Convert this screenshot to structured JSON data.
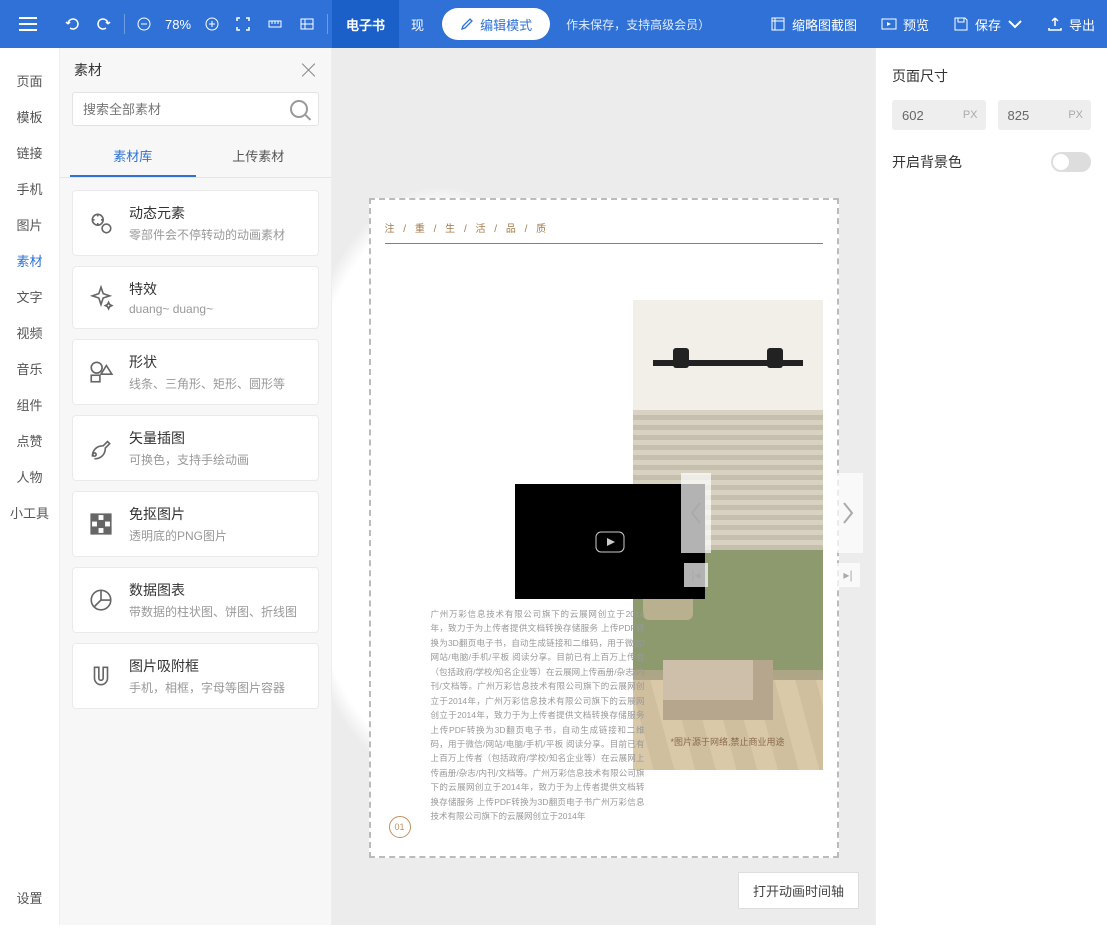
{
  "topbar": {
    "zoom": "78%",
    "mode_tabs": {
      "active": "电子书",
      "other": "现"
    },
    "edit_pill": "编辑模式",
    "status": "作未保存，支持高级会员）",
    "thumbnail": "缩略图截图",
    "preview": "预览",
    "save": "保存",
    "export": "导出"
  },
  "rail": {
    "items": [
      "页面",
      "模板",
      "链接",
      "手机",
      "图片",
      "素材",
      "文字",
      "视频",
      "音乐",
      "组件",
      "点赞",
      "人物",
      "小工具"
    ],
    "active_index": 5,
    "bottom": "设置"
  },
  "panel": {
    "title": "素材",
    "search_placeholder": "搜索全部素材",
    "tabs": {
      "library": "素材库",
      "upload": "上传素材"
    },
    "cards": [
      {
        "title": "动态元素",
        "desc": "零部件会不停转动的动画素材"
      },
      {
        "title": "特效",
        "desc": "duang~ duang~"
      },
      {
        "title": "形状",
        "desc": "线条、三角形、矩形、圆形等"
      },
      {
        "title": "矢量插图",
        "desc": "可换色，支持手绘动画"
      },
      {
        "title": "免抠图片",
        "desc": "透明底的PNG图片"
      },
      {
        "title": "数据图表",
        "desc": "带数据的柱状图、饼图、折线图"
      },
      {
        "title": "图片吸附框",
        "desc": "手机，相框，字母等图片容器"
      }
    ]
  },
  "canvas": {
    "header_text": "注 / 重 / 生 / 活 / 品 / 质",
    "photo_caption": "*图片源于网络,禁止商业用途",
    "body_text": "广州万彩信息技术有限公司旗下的云展网创立于2014年，致力于为上传者提供文档转换存储服务 上传PDF转换为3D翻页电子书，自动生成链接和二维码，用于微信/网站/电脑/手机/平板 阅读分享。目前已有上百万上传者（包括政府/学校/知名企业等）在云展网上传画册/杂志/内刊/文档等。广州万彩信息技术有限公司旗下的云展网创立于2014年，广州万彩信息技术有限公司旗下的云展网创立于2014年，致力于为上传者提供文档转换存储服务 上传PDF转换为3D翻页电子书，自动生成链接和二维码，用于微信/网站/电脑/手机/平板 阅读分享。目前已有上百万上传者（包括政府/学校/知名企业等）在云展网上传画册/杂志/内刊/文档等。广州万彩信息技术有限公司旗下的云展网创立于2014年，致力于为上传者提供文档转换存储服务 上传PDF转换为3D翻页电子书广州万彩信息技术有限公司旗下的云展网创立于2014年",
    "page_num": "01",
    "timeline_btn": "打开动画时间轴"
  },
  "props": {
    "dim_title": "页面尺寸",
    "width": "602",
    "height": "825",
    "unit": "PX",
    "bg_label": "开启背景色"
  }
}
